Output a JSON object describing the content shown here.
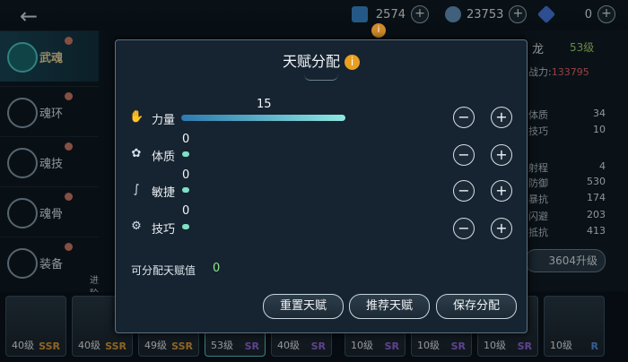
{
  "topbar": {
    "back_icon": "back-arrow-icon",
    "currencies": [
      {
        "icon": "crystal-icon",
        "value": "2574",
        "color": "#3a8fd8"
      },
      {
        "icon": "soul-coin-icon",
        "value": "23753",
        "color": "#6a9cc8"
      },
      {
        "icon": "blue-gem-icon",
        "value": "0",
        "color": "#4a7ee8"
      }
    ]
  },
  "sidebar": {
    "items": [
      {
        "label": "武魂",
        "icon": "martial-soul-icon",
        "active": true
      },
      {
        "label": "魂环",
        "icon": "soul-ring-icon"
      },
      {
        "label": "魂技",
        "icon": "soul-skill-icon"
      },
      {
        "label": "魂骨",
        "icon": "soul-bone-icon"
      },
      {
        "label": "装备",
        "icon": "equipment-icon"
      }
    ],
    "advance_label": "进阶加"
  },
  "right_panel": {
    "name": "龙",
    "level": "53级",
    "power_label": "战力:",
    "power_value": "133795",
    "stats": [
      {
        "label": "体质",
        "value": "34"
      },
      {
        "label": "技巧",
        "value": "10"
      },
      {
        "label": "射程",
        "value": "4"
      },
      {
        "label": "防御",
        "value": "530"
      },
      {
        "label": "暴抗",
        "value": "174"
      },
      {
        "label": "闪避",
        "value": "203"
      },
      {
        "label": "抵抗",
        "value": "413"
      }
    ],
    "upgrade_label": "3604升级"
  },
  "modal": {
    "title": "天赋分配",
    "attributes": [
      {
        "label": "力量",
        "value": "15",
        "icon": "strength-icon",
        "fill": 0.41
      },
      {
        "label": "体质",
        "value": "0",
        "icon": "constitution-icon",
        "fill": 0
      },
      {
        "label": "敏捷",
        "value": "0",
        "icon": "agility-icon",
        "fill": 0
      },
      {
        "label": "技巧",
        "value": "0",
        "icon": "skill-icon",
        "fill": 0
      }
    ],
    "minus": "−",
    "plus": "+",
    "available_label": "可分配天赋值",
    "available_value": "0",
    "buttons": {
      "reset": "重置天赋",
      "recommend": "推荐天赋",
      "save": "保存分配"
    }
  },
  "roster": [
    {
      "level": "40级",
      "rarity": "SSR",
      "rarity_color": "#e8a23a"
    },
    {
      "level": "40级",
      "rarity": "SSR",
      "rarity_color": "#e8a23a"
    },
    {
      "level": "49级",
      "rarity": "SSR",
      "rarity_color": "#e8a23a"
    },
    {
      "level": "53级",
      "rarity": "SR",
      "rarity_color": "#9a6ce8"
    },
    {
      "level": "40级",
      "rarity": "SR",
      "rarity_color": "#9a6ce8"
    },
    {
      "level": "10级",
      "rarity": "SR",
      "rarity_color": "#9a6ce8"
    },
    {
      "level": "10级",
      "rarity": "SR",
      "rarity_color": "#9a6ce8"
    },
    {
      "level": "10级",
      "rarity": "SR",
      "rarity_color": "#9a6ce8"
    },
    {
      "level": "10级",
      "rarity": "R",
      "rarity_color": "#5a9ae8"
    },
    {
      "level": "10级",
      "rarity": "R",
      "rarity_color": "#5a9ae8"
    }
  ]
}
